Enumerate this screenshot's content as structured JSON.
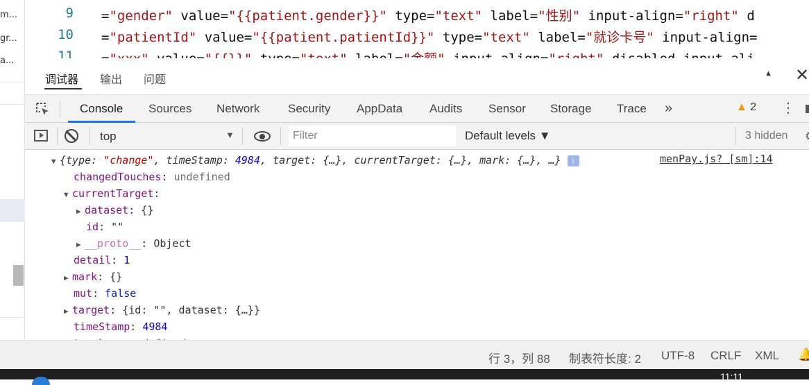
{
  "sidebar": {
    "items": [
      "m...",
      "gr...",
      "a..."
    ]
  },
  "editor": {
    "lines": [
      {
        "num": "9",
        "prefix": "=",
        "s1": "\"gender\"",
        "a1": " value=",
        "s2": "\"{{patient.gender}}\"",
        "a2": " type=",
        "s3": "\"text\"",
        "a3": " label=",
        "s4": "\"性别\"",
        "a4": " input-align=",
        "s5": "\"right\"",
        "tail": " d"
      },
      {
        "num": "10",
        "prefix": "=",
        "s1": "\"patientId\"",
        "a1": " value=",
        "s2": "\"{{patient.patientId}}\"",
        "a2": " type=",
        "s3": "\"text\"",
        "a3": " label=",
        "s4": "\"就诊卡号\"",
        "a4": " input-align=",
        "s5": "",
        "tail": ""
      },
      {
        "num": "11",
        "prefix": "=",
        "s1": "\"xxx\"",
        "a1": " value=",
        "s2": "\"{{}}\"",
        "a2": " type=",
        "s3": "\"text\"",
        "a3": " label=",
        "s4": "\"金额\"",
        "a4": " input-align=",
        "s5": "\"right\"",
        "tail": " disabled input-ali"
      }
    ]
  },
  "panel": {
    "tabs": [
      "调试器",
      "输出",
      "问题"
    ],
    "up_icon": "▲",
    "close_icon": "✕"
  },
  "devtools": {
    "tabs": [
      "Console",
      "Sources",
      "Network",
      "Security",
      "AppData",
      "Audits",
      "Sensor",
      "Storage",
      "Trace"
    ],
    "more": "»",
    "warning_count": "2",
    "warning_icon": "▲",
    "kebab": "⋮"
  },
  "console_toolbar": {
    "context": "top",
    "context_arrow": "▼",
    "filter_placeholder": "Filter",
    "levels": "Default levels ▼",
    "hidden": "3 hidden"
  },
  "console": {
    "summary": {
      "open": "{",
      "k1": "type",
      "v1": "\"change\"",
      "k2": "timeStamp",
      "v2": "4984",
      "k3": "target",
      "v3": "{…}",
      "k4": "currentTarget",
      "v4": "{…}",
      "k5": "mark",
      "v5": "{…}",
      "rest": "…}",
      "info": "i"
    },
    "source": "menPay.js? [sm]:14",
    "rows": [
      {
        "key": "changedTouches",
        "value": "undefined",
        "kind": "grey"
      },
      {
        "key": "currentTarget",
        "value": "",
        "kind": "plain"
      },
      {
        "key": "dataset",
        "value": "{}",
        "kind": "plain"
      },
      {
        "key": "id",
        "value": "\"\"",
        "kind": "plain"
      },
      {
        "key": "__proto__",
        "value": "Object",
        "kind": "plain"
      },
      {
        "key": "detail",
        "value": "1",
        "kind": "num"
      },
      {
        "key": "mark",
        "value": "{}",
        "kind": "plain"
      },
      {
        "key": "mut",
        "value": "false",
        "kind": "kw"
      },
      {
        "key": "target",
        "value": "{id: \"\", dataset: {…}}",
        "kind": "plain"
      },
      {
        "key": "timeStamp",
        "value": "4984",
        "kind": "num"
      },
      {
        "key": "touches",
        "value": "undefined",
        "kind": "grey"
      }
    ]
  },
  "statusbar": {
    "position": "行 3，列 88",
    "tab_size": "制表符长度: 2",
    "encoding": "UTF-8",
    "eol": "CRLF",
    "language": "XML",
    "bell_icon": "🔔"
  },
  "taskbar": {
    "clock": "11:11"
  },
  "colors": {
    "accent": "#1a73e8",
    "warning": "#f29900",
    "key": "#881280",
    "string": "#c80000",
    "number": "#1c00cf"
  }
}
